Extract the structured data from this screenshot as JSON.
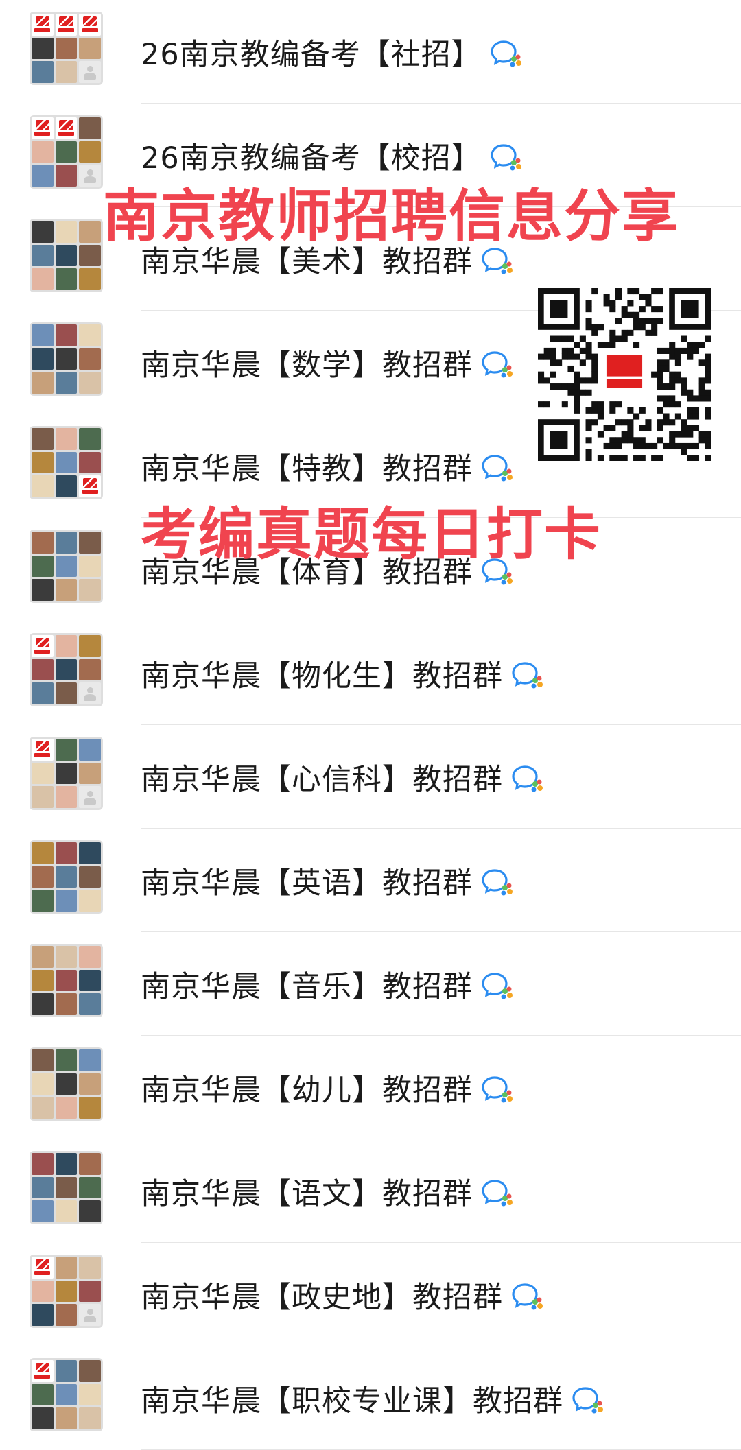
{
  "groups": [
    {
      "title": "26南京教编备考【社招】",
      "avatar": [
        "logo",
        "logo",
        "logo",
        "p1",
        "p2",
        "p3",
        "p4",
        "p5",
        "empty"
      ]
    },
    {
      "title": "26南京教编备考【校招】",
      "avatar": [
        "logo",
        "logo",
        "p6",
        "p7",
        "p8",
        "p9",
        "p10",
        "p11",
        "empty"
      ]
    },
    {
      "title": "南京华晨【美术】教招群",
      "avatar": [
        "p1",
        "p12",
        "p3",
        "p4",
        "p13",
        "p6",
        "p7",
        "p8",
        "p9"
      ]
    },
    {
      "title": "南京华晨【数学】教招群",
      "avatar": [
        "p10",
        "p11",
        "p12",
        "p13",
        "p1",
        "p2",
        "p3",
        "p4",
        "p5"
      ]
    },
    {
      "title": "南京华晨【特教】教招群",
      "avatar": [
        "p6",
        "p7",
        "p8",
        "p9",
        "p10",
        "p11",
        "p12",
        "p13",
        "logo"
      ]
    },
    {
      "title": "南京华晨【体育】教招群",
      "avatar": [
        "p2",
        "p4",
        "p6",
        "p8",
        "p10",
        "p12",
        "p1",
        "p3",
        "p5"
      ]
    },
    {
      "title": "南京华晨【物化生】教招群",
      "avatar": [
        "logo",
        "p7",
        "p9",
        "p11",
        "p13",
        "p2",
        "p4",
        "p6",
        "empty"
      ]
    },
    {
      "title": "南京华晨【心信科】教招群",
      "avatar": [
        "logo",
        "p8",
        "p10",
        "p12",
        "p1",
        "p3",
        "p5",
        "p7",
        "empty"
      ]
    },
    {
      "title": "南京华晨【英语】教招群",
      "avatar": [
        "p9",
        "p11",
        "p13",
        "p2",
        "p4",
        "p6",
        "p8",
        "p10",
        "p12"
      ]
    },
    {
      "title": "南京华晨【音乐】教招群",
      "avatar": [
        "p3",
        "p5",
        "p7",
        "p9",
        "p11",
        "p13",
        "p1",
        "p2",
        "p4"
      ]
    },
    {
      "title": "南京华晨【幼儿】教招群",
      "avatar": [
        "p6",
        "p8",
        "p10",
        "p12",
        "p1",
        "p3",
        "p5",
        "p7",
        "p9"
      ]
    },
    {
      "title": "南京华晨【语文】教招群",
      "avatar": [
        "p11",
        "p13",
        "p2",
        "p4",
        "p6",
        "p8",
        "p10",
        "p12",
        "p1"
      ]
    },
    {
      "title": "南京华晨【政史地】教招群",
      "avatar": [
        "logo",
        "p3",
        "p5",
        "p7",
        "p9",
        "p11",
        "p13",
        "p2",
        "empty"
      ]
    },
    {
      "title": "南京华晨【职校专业课】教招群",
      "avatar": [
        "logo",
        "p4",
        "p6",
        "p8",
        "p10",
        "p12",
        "p1",
        "p3",
        "p5"
      ]
    }
  ],
  "overlay": {
    "headline": "南京教师招聘信息分享",
    "subline": "考编真题每日打卡"
  },
  "colors": {
    "overlay_red": "#f0444f",
    "divider": "#e6e6e6",
    "title_text": "#1b1b1b",
    "wecom_blue": "#2b8cf0",
    "wecom_green": "#5cc05c",
    "wecom_orange": "#f5a623"
  },
  "icons": {
    "group_icon": "wecom-icon",
    "qr": "qr-code-icon"
  }
}
